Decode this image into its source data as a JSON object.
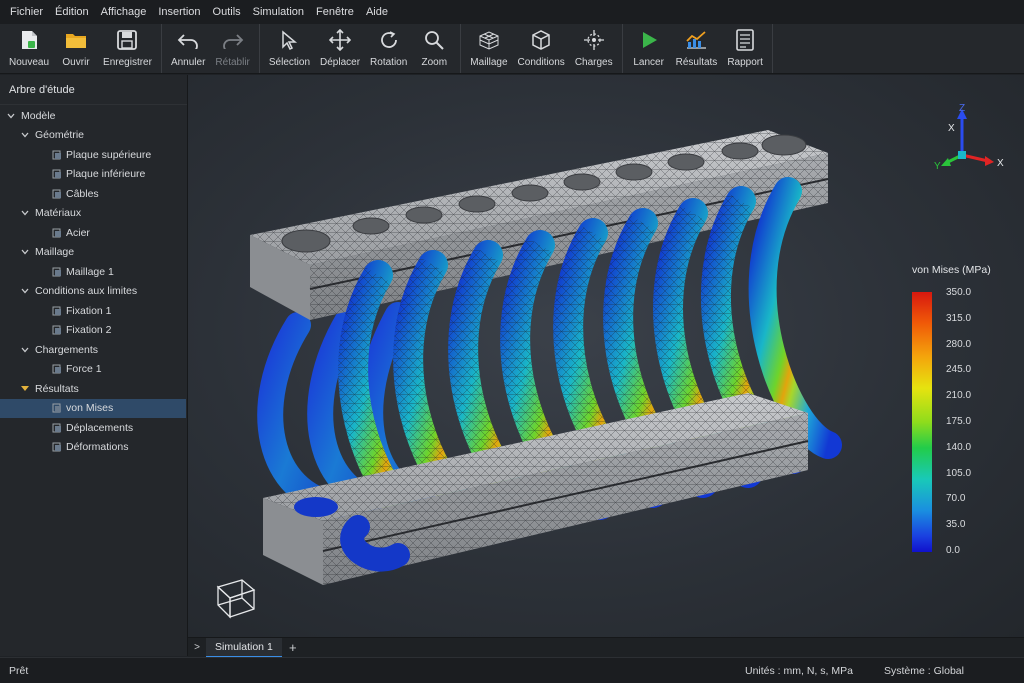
{
  "menu": [
    "Fichier",
    "Édition",
    "Affichage",
    "Insertion",
    "Outils",
    "Simulation",
    "Fenêtre",
    "Aide"
  ],
  "toolbar": {
    "file": [
      {
        "label": "Nouveau",
        "icon": "new-file-icon"
      },
      {
        "label": "Ouvrir",
        "icon": "folder-icon"
      },
      {
        "label": "Enregistrer",
        "icon": "save-icon"
      }
    ],
    "edit": [
      {
        "label": "Annuler",
        "icon": "undo-icon"
      },
      {
        "label": "Rétablir",
        "icon": "redo-icon"
      }
    ],
    "view": [
      {
        "label": "Sélection",
        "icon": "cursor-icon"
      },
      {
        "label": "Déplacer",
        "icon": "move-icon"
      },
      {
        "label": "Rotation",
        "icon": "rotate-icon"
      },
      {
        "label": "Zoom",
        "icon": "zoom-icon"
      }
    ],
    "setup": [
      {
        "label": "Maillage",
        "icon": "mesh-icon"
      },
      {
        "label": "Conditions",
        "icon": "cube-icon"
      },
      {
        "label": "Charges",
        "icon": "loads-icon"
      }
    ],
    "run": [
      {
        "label": "Lancer",
        "icon": "play-icon"
      },
      {
        "label": "Résultats",
        "icon": "chart-icon"
      },
      {
        "label": "Rapport",
        "icon": "report-icon"
      }
    ]
  },
  "tree": {
    "title": "Arbre d'étude",
    "nodes": [
      {
        "label": "Modèle",
        "level": 0,
        "kind": "branch"
      },
      {
        "label": "Géométrie",
        "level": 1,
        "kind": "branch"
      },
      {
        "label": "Plaque supérieure",
        "level": 2,
        "kind": "leaf"
      },
      {
        "label": "Plaque inférieure",
        "level": 2,
        "kind": "leaf"
      },
      {
        "label": "Câbles",
        "level": 2,
        "kind": "leaf"
      },
      {
        "label": "Matériaux",
        "level": 1,
        "kind": "branch"
      },
      {
        "label": "Acier",
        "level": 2,
        "kind": "leaf"
      },
      {
        "label": "Maillage",
        "level": 1,
        "kind": "branch"
      },
      {
        "label": "Maillage 1",
        "level": 2,
        "kind": "leaf"
      },
      {
        "label": "Conditions aux limites",
        "level": 1,
        "kind": "branch"
      },
      {
        "label": "Fixation 1",
        "level": 2,
        "kind": "leaf"
      },
      {
        "label": "Fixation 2",
        "level": 2,
        "kind": "leaf"
      },
      {
        "label": "Chargements",
        "level": 1,
        "kind": "branch"
      },
      {
        "label": "Force 1",
        "level": 2,
        "kind": "leaf"
      },
      {
        "label": "Résultats",
        "level": 1,
        "kind": "branch-results"
      },
      {
        "label": "von Mises",
        "level": 2,
        "kind": "leaf",
        "selected": true
      },
      {
        "label": "Déplacements",
        "level": 2,
        "kind": "leaf"
      },
      {
        "label": "Déformations",
        "level": 2,
        "kind": "leaf"
      }
    ]
  },
  "legend": {
    "title": "von Mises (MPa)",
    "values": [
      "350.0",
      "315.0",
      "280.0",
      "245.0",
      "210.0",
      "175.0",
      "140.0",
      "105.0",
      "70.0",
      "35.0",
      "0.0"
    ]
  },
  "triad": {
    "x": "X",
    "y": "Y",
    "z": "Z"
  },
  "tabs": [
    "Simulation 1"
  ],
  "status": {
    "left": "Prêt",
    "units": "Unités : mm, N, s, MPa",
    "system": "Système : Global"
  }
}
